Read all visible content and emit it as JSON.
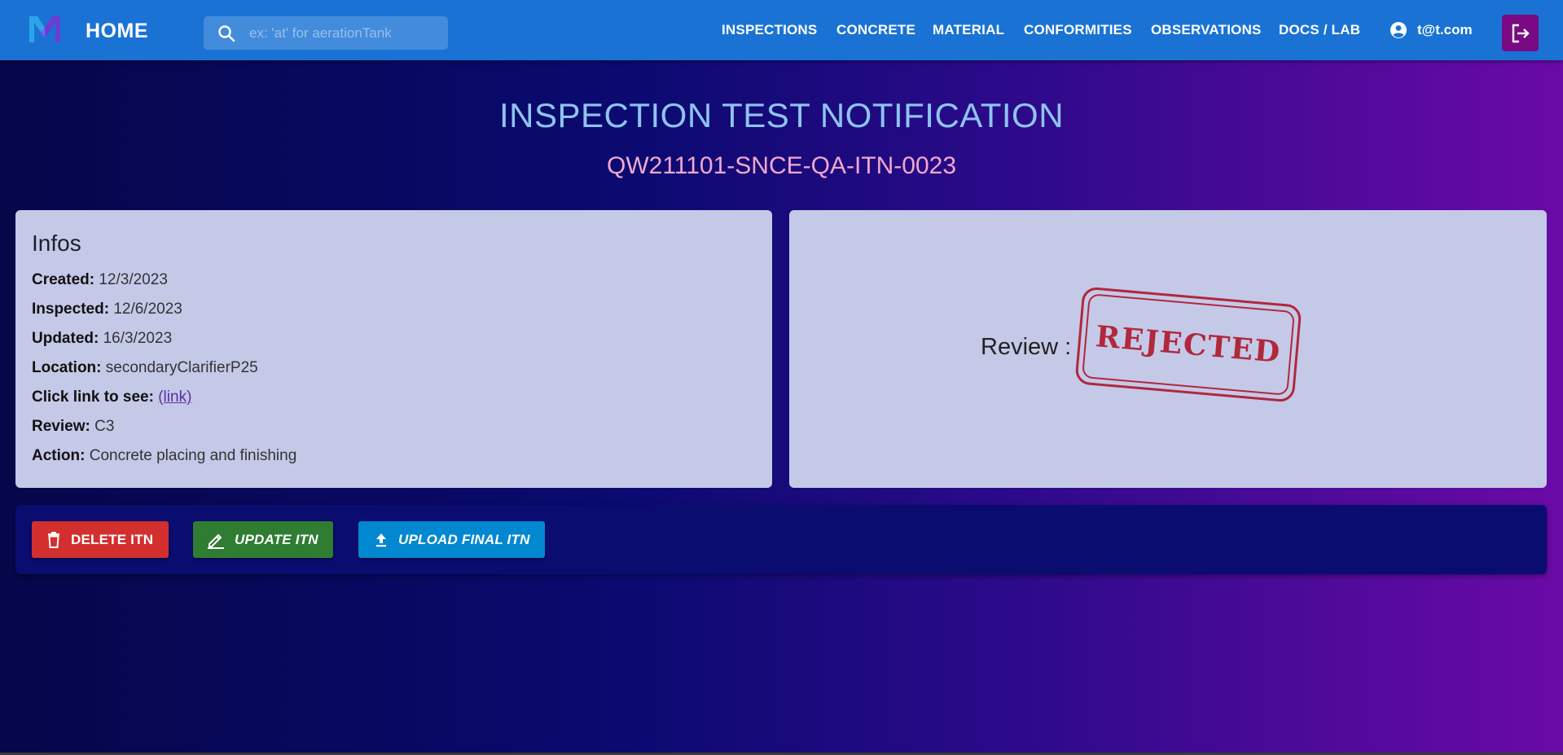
{
  "header": {
    "home_label": "HOME",
    "search_placeholder": "ex: 'at' for aerationTank",
    "nav": [
      "INSPECTIONS",
      "CONCRETE",
      "MATERIAL",
      "CONFORMITIES",
      "OBSERVATIONS",
      "DOCS / LAB"
    ],
    "user_email": "t@t.com"
  },
  "page": {
    "title": "INSPECTION TEST NOTIFICATION",
    "reference": "QW211101-SNCE-QA-ITN-0023"
  },
  "infos": {
    "heading": "Infos",
    "rows": [
      {
        "label": "Created:",
        "value": "12/3/2023"
      },
      {
        "label": "Inspected:",
        "value": "12/6/2023"
      },
      {
        "label": "Updated:",
        "value": "16/3/2023"
      },
      {
        "label": "Location:",
        "value": "secondaryClarifierP25"
      },
      {
        "label": "Click link to see:",
        "link": "(link)"
      },
      {
        "label": "Review:",
        "value": "C3"
      },
      {
        "label": "Action:",
        "value": "Concrete placing and finishing"
      }
    ]
  },
  "review": {
    "label": "Review :",
    "stamp": "REJECTED",
    "stamp_color": "#b0283c"
  },
  "actions": {
    "delete_label": "DELETE ITN",
    "update_label": "UPDATE ITN",
    "upload_label": "UPLOAD FINAL ITN"
  },
  "colors": {
    "topbar": "#1a73d4",
    "title": "#8fc3f0",
    "subtitle": "#f2a7cf",
    "card": "#c5c9e8",
    "delete": "#d32f2f",
    "update": "#2e7d32",
    "upload": "#0288d1",
    "logout": "#7a0a84"
  },
  "icons": [
    "app-logo-icon",
    "search-icon",
    "account-circle-icon",
    "logout-icon",
    "trash-icon",
    "edit-icon",
    "upload-icon"
  ]
}
